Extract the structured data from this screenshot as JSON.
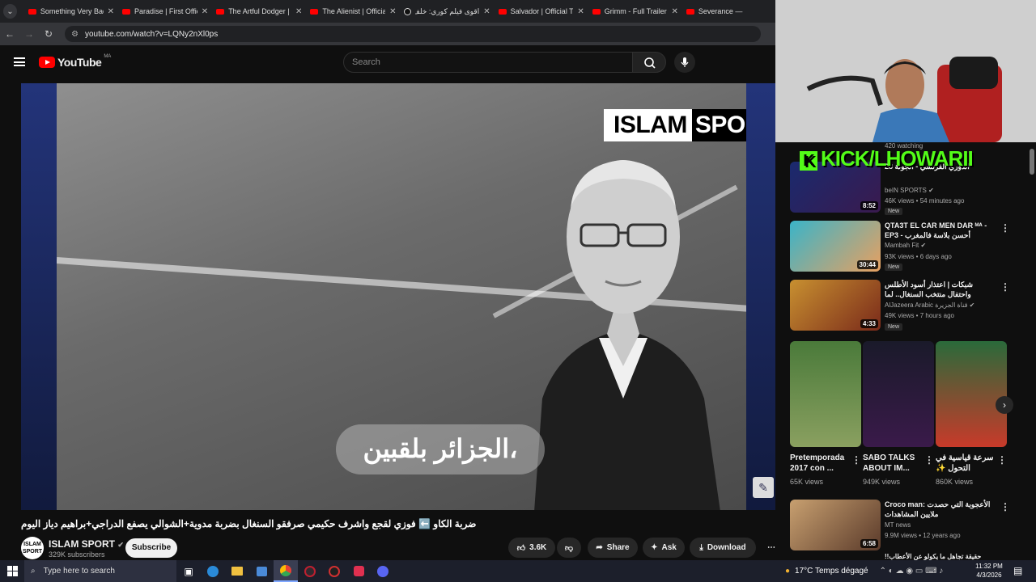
{
  "browser": {
    "tabs": [
      {
        "label": "Something Very Bad",
        "icon": "youtube-icon"
      },
      {
        "label": "Paradise | First Official",
        "icon": "youtube-icon"
      },
      {
        "label": "The Artful Dodger | O",
        "icon": "youtube-icon"
      },
      {
        "label": "The Alienist | Official",
        "icon": "youtube-icon"
      },
      {
        "label": "اقوى فيلم كوري: خلف",
        "icon": "tiktok-icon"
      },
      {
        "label": "Salvador | Official Tra",
        "icon": "youtube-icon"
      },
      {
        "label": "Grimm - Full Trailer -",
        "icon": "youtube-icon"
      },
      {
        "label": "Severance —",
        "icon": "youtube-icon"
      }
    ],
    "url": "youtube.com/watch?v=LQNy2nXl0ps"
  },
  "youtube": {
    "logo_text": "YouTube",
    "logo_region": "MA",
    "search_placeholder": "Search"
  },
  "player": {
    "channel_overlay_left": "ISLAM",
    "channel_overlay_right": "SPORT",
    "subtitle_text": "الجزائر بلقبين،"
  },
  "video": {
    "title": "ضربة الكاو ⬅️ فوزي لقجع واشرف حكيمي صرفقو السنغال بضربة مدوية+الشوالي يصفع الدراجي+براهيم دياز اليوم",
    "channel_name": "ISLAM SPORT",
    "channel_avatar_text": "ISLAM SPORT",
    "subscribers": "329K subscribers",
    "subscribe_label": "Subscribe",
    "likes": "3.6K",
    "share_label": "Share",
    "ask_label": "Ask",
    "download_label": "Download"
  },
  "overlay": {
    "kick_text": "KICK/LHOWARII"
  },
  "sidebar": {
    "top_partial_meta": "420 watching",
    "recommendations": [
      {
        "title": "الدوري الفرنسي - الجولة 28",
        "channel": "beIN SPORTS",
        "verified": true,
        "meta": "46K views • 54 minutes ago",
        "badge": "New",
        "duration": "8:52",
        "thumb_colors": [
          "#1a2a6e",
          "#3a1a4e"
        ]
      },
      {
        "title": "QTA3T EL CAR MEN DAR ᴹᴬ - EP3 - أحسن بلاسة فالمغرب",
        "channel": "Mambah Fit",
        "verified": true,
        "meta": "93K views • 6 days ago",
        "badge": "New",
        "duration": "30:44",
        "thumb_colors": [
          "#3ab4c8",
          "#e8a060"
        ]
      },
      {
        "title": "شبكات | اعتذار أسود الأطلس واحتفال منتخب السنغال.. لما القسمة؟",
        "channel": "AlJazeera Arabic قناة الجزيرة",
        "verified": true,
        "meta": "49K views • 7 hours ago",
        "badge": "New",
        "duration": "4:33",
        "thumb_colors": [
          "#c89030",
          "#7a2a1a"
        ]
      },
      {
        "title": "Croco man: الأعجوبة التي حصدت ملايين المشاهدات",
        "channel": "MT news",
        "verified": false,
        "meta": "9.9M views • 12 years ago",
        "badge": "",
        "duration": "6:58",
        "thumb_colors": [
          "#c8a070",
          "#5a3a2a"
        ]
      }
    ],
    "shorts": [
      {
        "title": "Pretemporada 2017 con ...",
        "views": "65K views",
        "colors": [
          "#4a7a3a",
          "#8aa060"
        ]
      },
      {
        "title": "SABO TALKS ABOUT IM...",
        "views": "949K views",
        "colors": [
          "#1a1a2a",
          "#3a1a4a"
        ]
      },
      {
        "title": "سرعة قياسية في التحول ✨",
        "views": "860K views",
        "colors": [
          "#2a6a3a",
          "#c83a2a"
        ]
      }
    ],
    "bottom_partial_title": "حقيقة تجاهل ما يكولو عن الأعطاب!!"
  },
  "taskbar": {
    "search_placeholder": "Type here to search",
    "weather": "17°C  Temps dégagé",
    "time": "11:32 PM",
    "date": "4/3/2026"
  },
  "colors": {
    "youtube_red": "#ff0000",
    "kick_green": "#53fc18",
    "page_bg": "#0f0f0f"
  }
}
